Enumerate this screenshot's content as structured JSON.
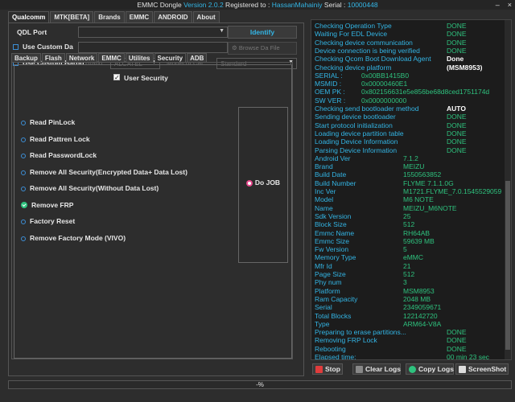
{
  "window": {
    "title_prefix": "EMMC Dongle ",
    "version": "Version 2.0.2",
    "registered": " Registered to : ",
    "user": "HassanMahainiy",
    "serial_label": " Serial : ",
    "serial": "10000448",
    "min": "–",
    "close": "×"
  },
  "tabs": [
    "Qualcomm",
    "MTK[BETA]",
    "Brands",
    "EMMC",
    "ANDROID",
    "About"
  ],
  "qdl": {
    "label": "QDL Port",
    "identify": "Identify"
  },
  "custom_da": {
    "label": "Use Custom Da",
    "browse": "Browse Da File"
  },
  "custom_barnd": {
    "label": "Use Custom Barnd",
    "brand_label": "Brand",
    "brand_value": "ALCATEL",
    "model_label": "Model of Car",
    "model_value": "Standard"
  },
  "subtabs": [
    "Backup",
    "Flash",
    "Network",
    "EMMC",
    "Utilites",
    "Security",
    "ADB"
  ],
  "security": {
    "title": "User Security",
    "options": [
      "Read PinLock",
      "Read Pattren Lock",
      "Read PasswordLock",
      "Remove All Security(Encrypted Data+ Data Lost)",
      "Remove All Security(Without Data Lost)",
      "Remove FRP",
      "Factory Reset",
      "Remove Factory Mode (VIVO)"
    ],
    "selected_index": 5,
    "do_job": "Do JOB"
  },
  "log": [
    {
      "k": "Checking Operation Type",
      "v": "DONE",
      "type": "status"
    },
    {
      "k": "Waiting For EDL Device",
      "v": "DONE",
      "type": "status"
    },
    {
      "k": "Checking device communication",
      "v": "DONE",
      "type": "status"
    },
    {
      "k": "Device connection is being verified",
      "v": "DONE",
      "type": "status"
    },
    {
      "k": "Checking Qcom Boot Download Agent",
      "v": "Done",
      "type": "white"
    },
    {
      "k": "Checking device platform",
      "v": "(MSM8953)",
      "type": "white"
    },
    {
      "k": "SERIAL :",
      "v": "0x00BB1415B0",
      "type": "id"
    },
    {
      "k": "MSMID :",
      "v": "0x00000460E1",
      "type": "id"
    },
    {
      "k": "OEM PK :",
      "v": "0x802156631e5e856be68d8ced1751174d",
      "type": "id"
    },
    {
      "k": "SW VER :",
      "v": "0x0000000000",
      "type": "id"
    },
    {
      "k": "Checking send bootloader method",
      "v": "AUTO",
      "type": "white"
    },
    {
      "k": "Sending device bootloader",
      "v": "DONE",
      "type": "status"
    },
    {
      "k": "Start protocol initialization",
      "v": "DONE",
      "type": "status"
    },
    {
      "k": "Loading device partition table",
      "v": "DONE",
      "type": "status"
    },
    {
      "k": "Loading Device Information",
      "v": "DONE",
      "type": "status"
    },
    {
      "k": "Parsing Device Information",
      "v": "DONE",
      "type": "status"
    },
    {
      "k": "Android Ver",
      "v": "7.1.2",
      "type": "info"
    },
    {
      "k": "Brand",
      "v": "MEIZU",
      "type": "info"
    },
    {
      "k": "Build Date",
      "v": "1550563852",
      "type": "info"
    },
    {
      "k": "Build Number",
      "v": "FLYME 7.1.1.0G",
      "type": "info"
    },
    {
      "k": "Inc Ver",
      "v": "M1721.FLYME_7.0.1545529059",
      "type": "info"
    },
    {
      "k": "Model",
      "v": "M6 NOTE",
      "type": "info"
    },
    {
      "k": "Name",
      "v": "MEIZU_M6NOTE",
      "type": "info"
    },
    {
      "k": "Sdk Version",
      "v": "25",
      "type": "info"
    },
    {
      "k": "Block Size",
      "v": "512",
      "type": "info"
    },
    {
      "k": "Emmc Name",
      "v": "RH64AB",
      "type": "info"
    },
    {
      "k": "Emmc Size",
      "v": "59639 MB",
      "type": "info"
    },
    {
      "k": "Fw Version",
      "v": "5",
      "type": "info"
    },
    {
      "k": "Memory Type",
      "v": "eMMC",
      "type": "info"
    },
    {
      "k": "Mfr Id",
      "v": "21",
      "type": "info"
    },
    {
      "k": "Page Size",
      "v": "512",
      "type": "info"
    },
    {
      "k": "Phy num",
      "v": "3",
      "type": "info"
    },
    {
      "k": "Platform",
      "v": "MSM8953",
      "type": "info"
    },
    {
      "k": "Ram Capacity",
      "v": "2048 MB",
      "type": "info"
    },
    {
      "k": "Serial",
      "v": "2349059671",
      "type": "info"
    },
    {
      "k": "Total Blocks",
      "v": "122142720",
      "type": "info"
    },
    {
      "k": "Type",
      "v": "ARM64-V8A",
      "type": "info"
    },
    {
      "k": "Preparing to erase partitions...",
      "v": "DONE",
      "type": "status"
    },
    {
      "k": "Removing FRP Lock",
      "v": "DONE",
      "type": "status"
    },
    {
      "k": "Rebooting",
      "v": "DONE",
      "type": "status"
    },
    {
      "k": "Elapsed time:",
      "v": "00 min  23 sec",
      "type": "elapsed"
    }
  ],
  "buttons": {
    "stop": "Stop",
    "clear": "Clear Logs",
    "copy": "Copy Logs",
    "screenshot": "ScreenShot"
  },
  "status": {
    "progress": "-%"
  },
  "colors": {
    "accent": "#33b5e5",
    "done": "#2ec27e",
    "bg": "#2d2d2d"
  }
}
